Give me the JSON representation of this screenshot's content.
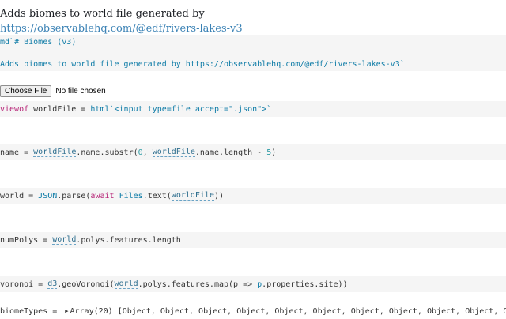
{
  "intro": {
    "text": "Adds biomes to world file generated by ",
    "link": "https://observablehq.com/@edf/rivers-lakes-v3"
  },
  "md_cell": {
    "kw": "md",
    "line1": "`# Biomes (v3)",
    "line2": "Adds biomes to world file generated by https://observablehq.com/@edf/rivers-lakes-v3`"
  },
  "file_input": {
    "button_label": "Choose File",
    "status": "No file chosen"
  },
  "cells": {
    "viewof": {
      "kw": "viewof",
      "rest": " worldFile = ",
      "fn": "html",
      "str": "`<input type=file accept=\".json\">`"
    },
    "name": {
      "lhs": "name = ",
      "ref1": "worldFile",
      "mid": ".name.substr(",
      "n0": "0",
      "comma": ", ",
      "ref2": "worldFile",
      "tail": ".name.length - ",
      "n5": "5",
      "close": ")"
    },
    "world": {
      "lhs": "world = ",
      "fn": "JSON",
      "mid": ".parse(",
      "kw": "await",
      "sp": " ",
      "files": "Files",
      "text": ".text(",
      "ref": "worldFile",
      "close": "))"
    },
    "numPolys": {
      "lhs": "numPolys = ",
      "ref": "world",
      "tail": ".polys.features.length"
    },
    "voronoi": {
      "lhs": "voronoi = ",
      "d3": "d3",
      "mid": ".geoVoronoi(",
      "ref": "world",
      "tail": ".polys.features.map(p => ",
      "p": "p",
      "end": ".properties.site))"
    },
    "biomeTypes": {
      "lhs": "biomeTypes = ",
      "arrow": "▶",
      "value": "Array(20) [Object, Object, Object, Object, Object, Object, Object, Object, Object, Object, Object,"
    }
  }
}
